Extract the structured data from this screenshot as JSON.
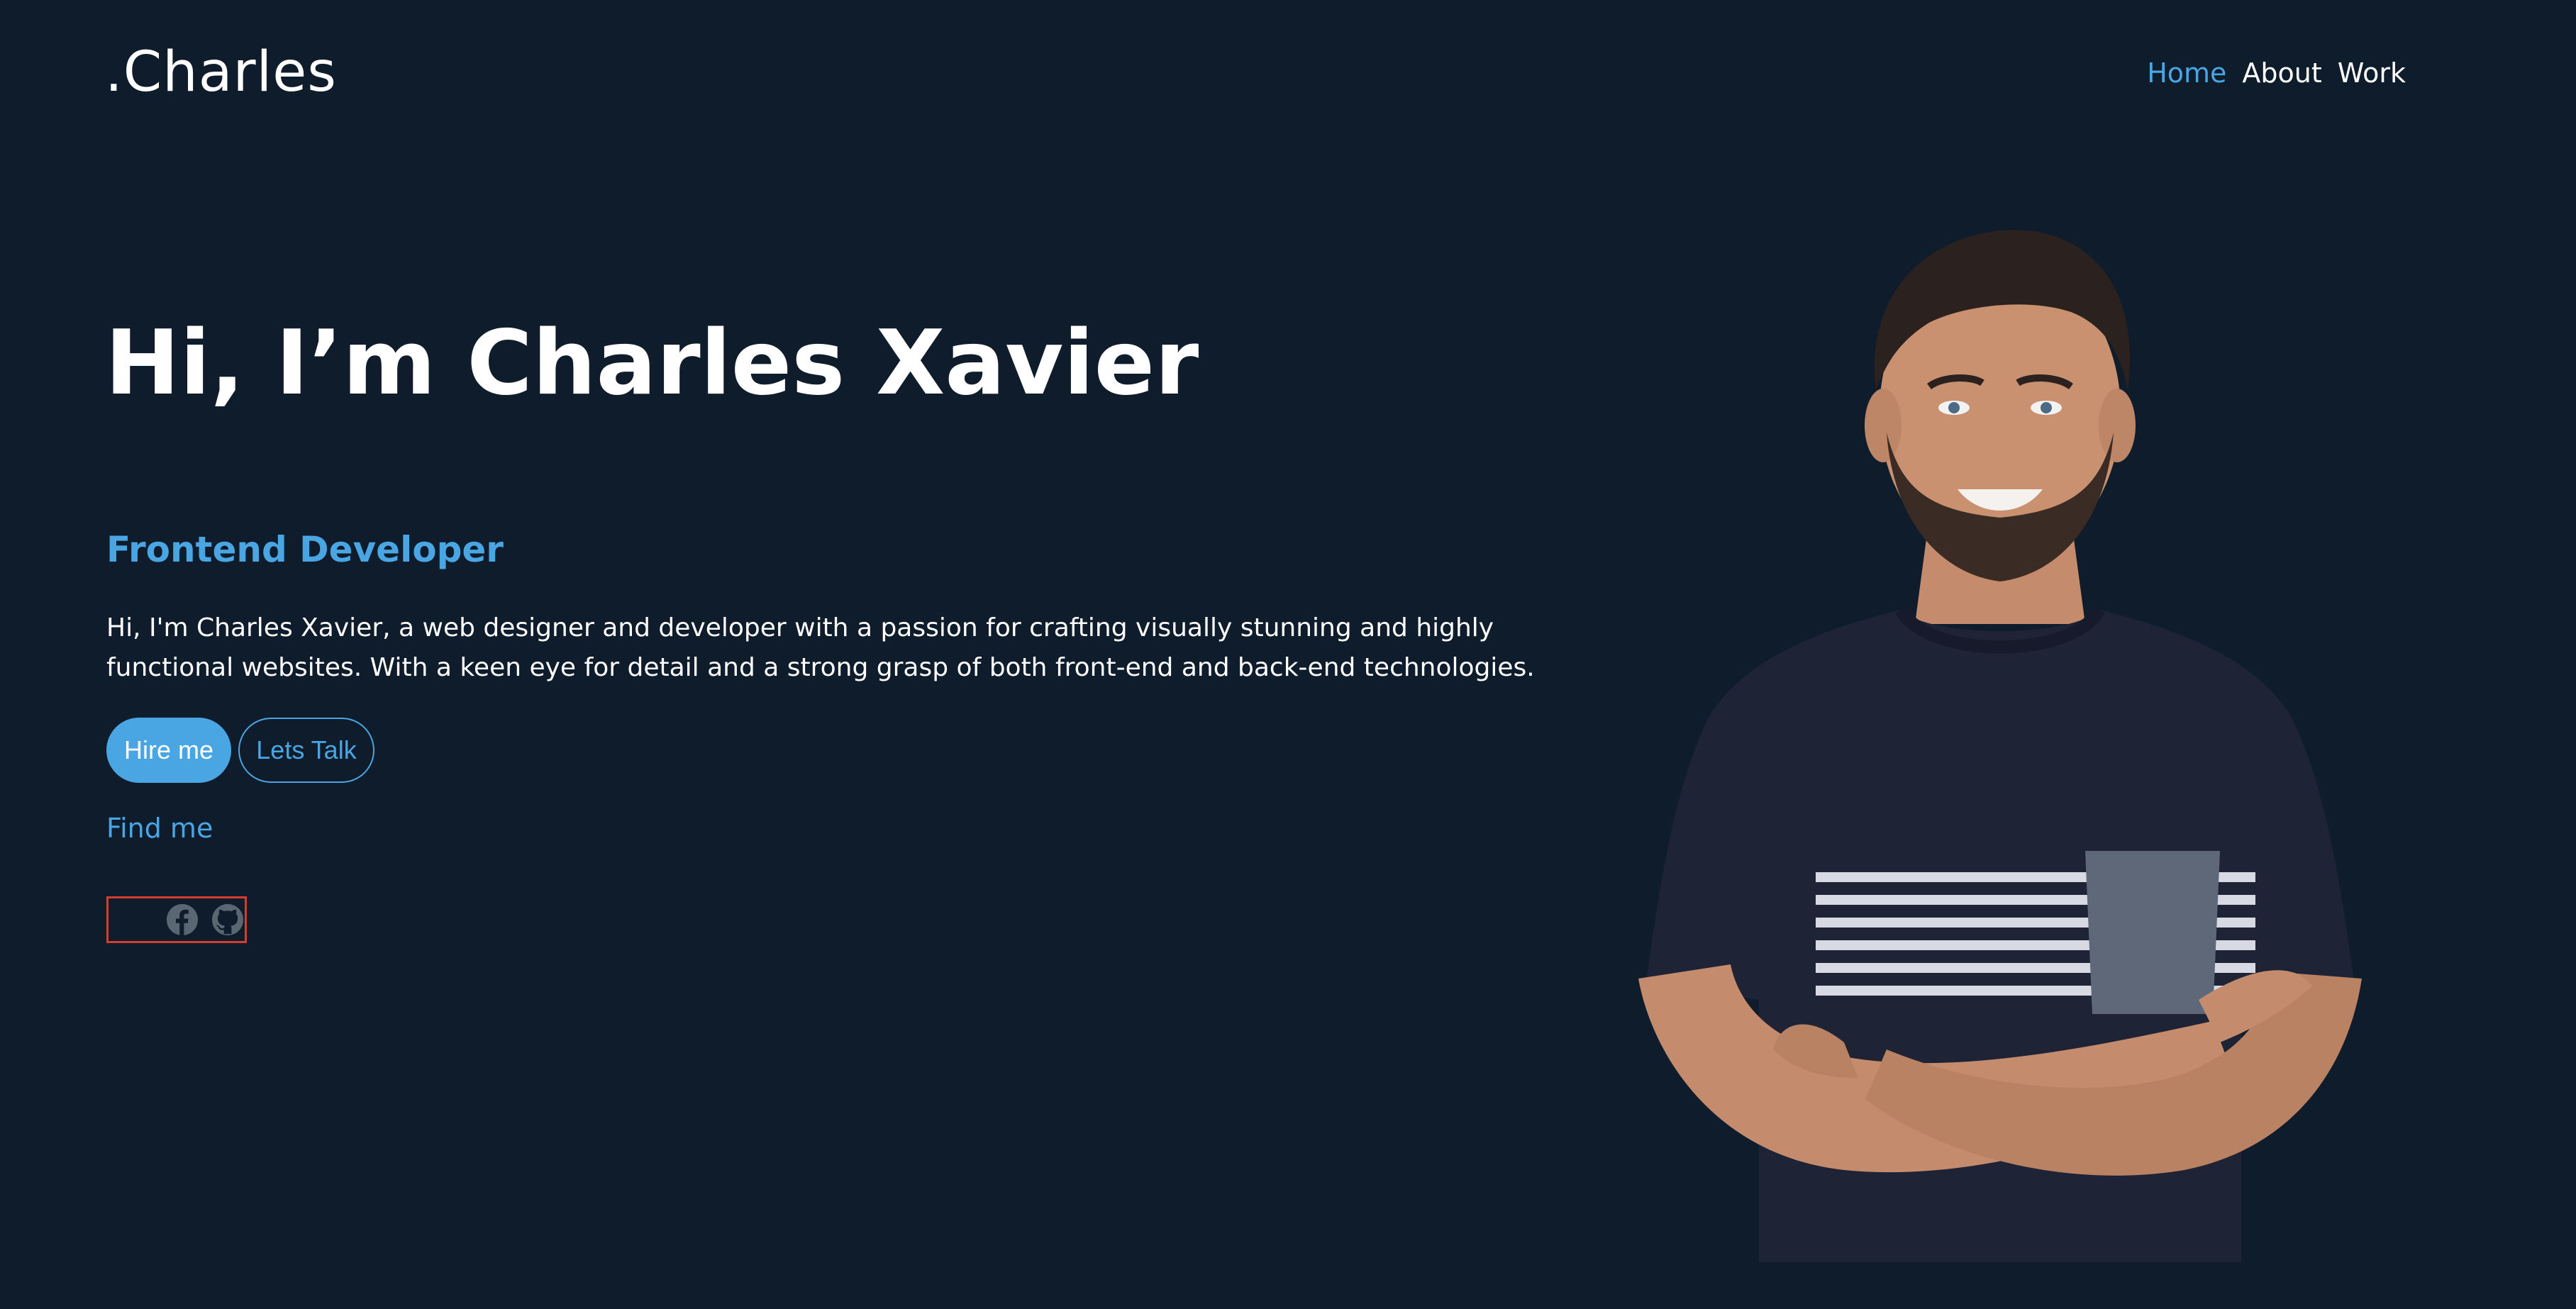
{
  "header": {
    "logo": ".Charles",
    "nav": [
      {
        "label": "Home",
        "active": true
      },
      {
        "label": "About",
        "active": false
      },
      {
        "label": "Work",
        "active": false
      }
    ]
  },
  "hero": {
    "headline": "Hi, I’m Charles Xavier",
    "role": "Frontend Developer",
    "bio": "Hi, I'm Charles Xavier, a web designer and developer with a passion for crafting visually stunning and highly functional websites. With a keen eye for detail and a strong grasp of both front-end and back-end technologies.",
    "primary_button": "Hire me",
    "secondary_button": "Lets Talk",
    "find_me": "Find me",
    "social_icons": [
      "facebook-icon",
      "github-icon"
    ]
  },
  "colors": {
    "background": "#0f1c2b",
    "accent": "#4aa6e3",
    "text": "#ffffff",
    "highlight_box": "#d53b2e"
  }
}
